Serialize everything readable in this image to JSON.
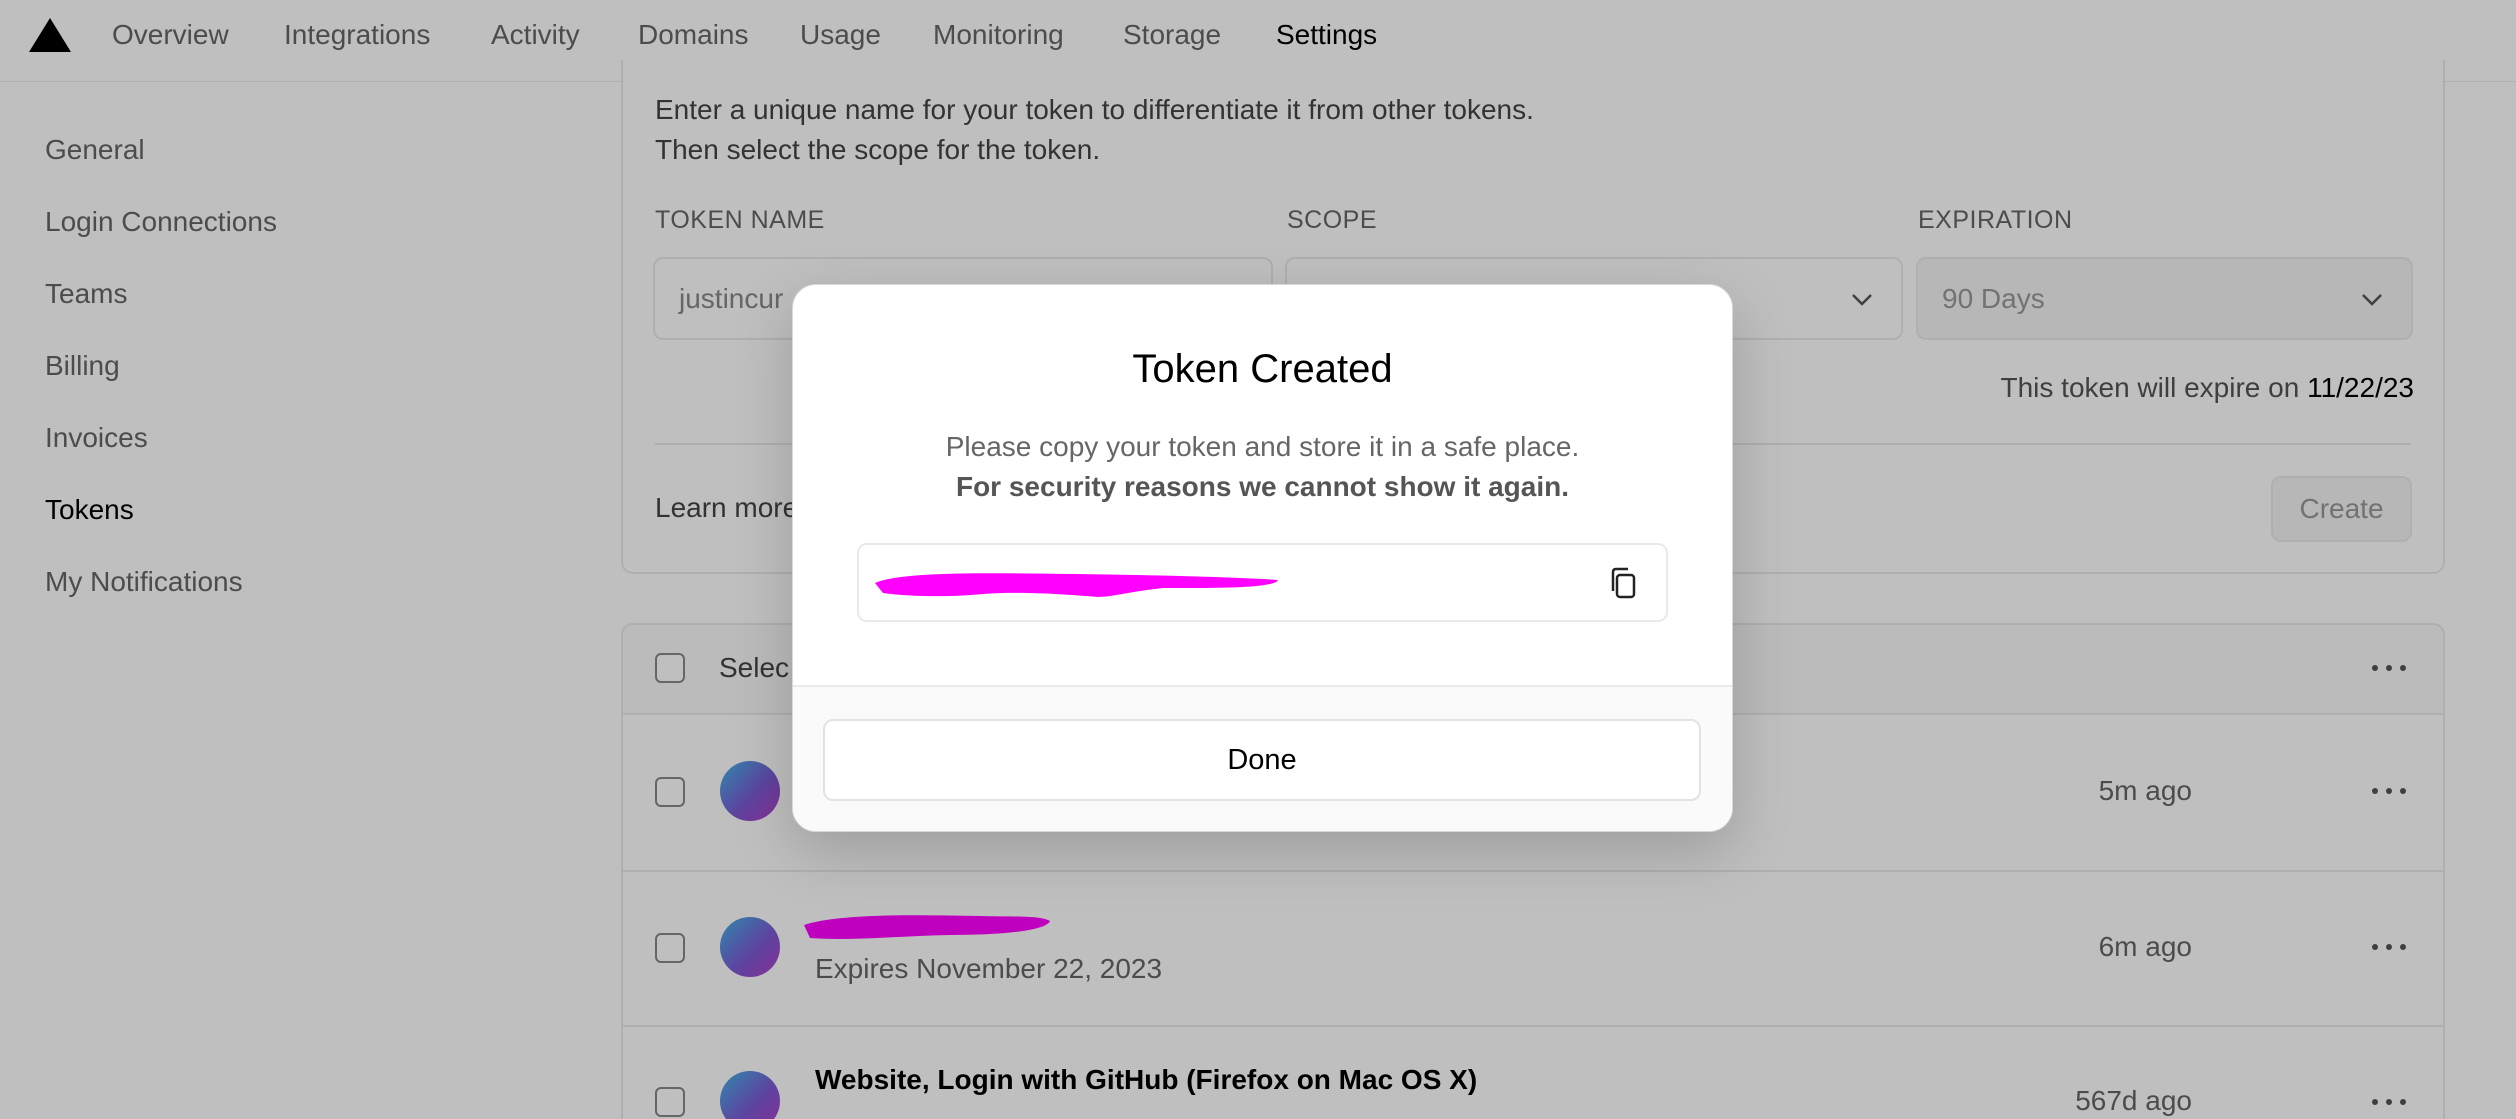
{
  "nav": {
    "tabs": [
      "Overview",
      "Integrations",
      "Activity",
      "Domains",
      "Usage",
      "Monitoring",
      "Storage",
      "Settings"
    ],
    "active": "Settings"
  },
  "sidebar": {
    "items": [
      "General",
      "Login Connections",
      "Teams",
      "Billing",
      "Invoices",
      "Tokens",
      "My Notifications"
    ],
    "active": "Tokens"
  },
  "form": {
    "desc_line1": "Enter a unique name for your token to differentiate it from other tokens.",
    "desc_line2": "Then select the scope for the token.",
    "token_name_label": "TOKEN NAME",
    "token_name_value": "justincur",
    "scope_label": "SCOPE",
    "expiration_label": "EXPIRATION",
    "expiration_value": "90 Days",
    "expire_prefix": "This token will expire on",
    "expire_date": "11/22/23",
    "learn_more": "Learn more",
    "create_label": "Create"
  },
  "list": {
    "select_label": "Selec",
    "rows": [
      {
        "title": "",
        "sub": "",
        "time": "5m ago"
      },
      {
        "title": "",
        "sub": "Expires November 22, 2023",
        "time": "6m ago"
      },
      {
        "title": "Website, Login with GitHub (Firefox on Mac OS X)",
        "sub": "",
        "time": "567d ago"
      }
    ]
  },
  "modal": {
    "title": "Token Created",
    "line1": "Please copy your token and store it in a safe place.",
    "line2": "For security reasons we cannot show it again.",
    "done_label": "Done"
  },
  "colors": {
    "redaction": "#ff00ff",
    "overlay": "rgba(0,0,0,0.25)"
  }
}
